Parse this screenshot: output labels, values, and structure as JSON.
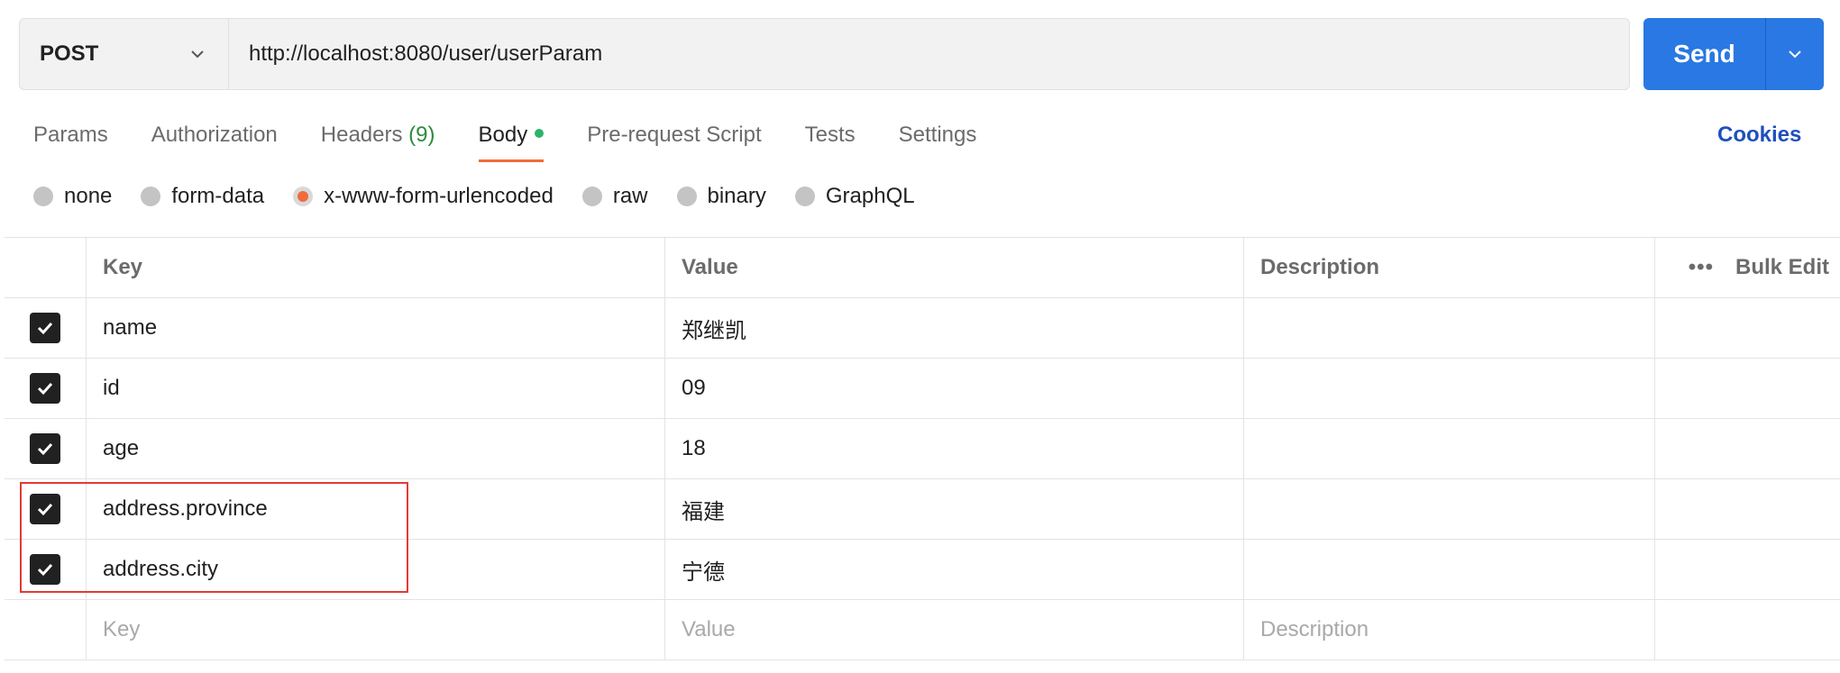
{
  "request": {
    "method": "POST",
    "url": "http://localhost:8080/user/userParam",
    "send_label": "Send"
  },
  "tabs": [
    {
      "label": "Params"
    },
    {
      "label": "Authorization"
    },
    {
      "label": "Headers",
      "count": "(9)"
    },
    {
      "label": "Body",
      "active": true
    },
    {
      "label": "Pre-request Script"
    },
    {
      "label": "Tests"
    },
    {
      "label": "Settings"
    }
  ],
  "cookies_label": "Cookies",
  "body_types": [
    {
      "label": "none"
    },
    {
      "label": "form-data"
    },
    {
      "label": "x-www-form-urlencoded",
      "selected": true
    },
    {
      "label": "raw"
    },
    {
      "label": "binary"
    },
    {
      "label": "GraphQL"
    }
  ],
  "table": {
    "headers": {
      "key": "Key",
      "value": "Value",
      "description": "Description",
      "more": "•••",
      "bulk_edit": "Bulk Edit"
    },
    "rows": [
      {
        "key": "name",
        "value": "郑继凯",
        "description": ""
      },
      {
        "key": "id",
        "value": "09",
        "description": ""
      },
      {
        "key": "age",
        "value": "18",
        "description": ""
      },
      {
        "key": "address.province",
        "value": "福建",
        "description": ""
      },
      {
        "key": "address.city",
        "value": "宁德",
        "description": ""
      }
    ],
    "placeholders": {
      "key": "Key",
      "value": "Value",
      "description": "Description"
    }
  },
  "colors": {
    "accent": "#f26b3a",
    "send": "#2a78e3",
    "cookies": "#1f4fbf",
    "highlight": "#e53935",
    "body_dot": "#2cb46d",
    "count": "#2e8b3e"
  },
  "icons": {
    "method_dropdown": "chevron-down-icon",
    "send_dropdown": "chevron-down-icon",
    "checkbox": "check-icon",
    "more": "more-dots-icon"
  }
}
